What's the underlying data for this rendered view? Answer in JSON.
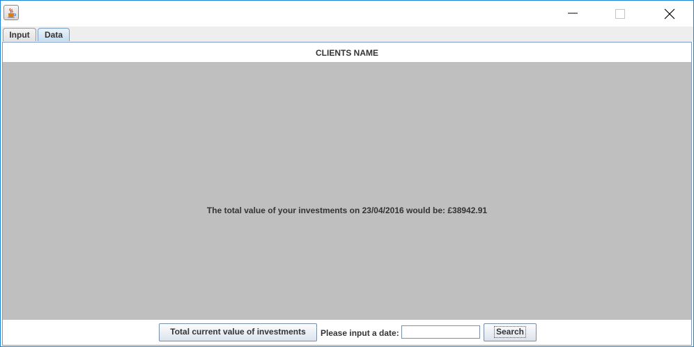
{
  "window": {
    "icon": "java-icon",
    "controls": {
      "minimize": "minimize-icon",
      "maximize": "maximize-icon",
      "close": "close-icon"
    }
  },
  "tabs": [
    {
      "label": "Input",
      "selected": false
    },
    {
      "label": "Data",
      "selected": true
    }
  ],
  "panel": {
    "header": "CLIENTS NAME",
    "result_text": "The total value of your investments on 23/04/2016 would be: £38942.91",
    "background_color": "#bfbfbf"
  },
  "footer": {
    "total_button_label": "Total current value of investments",
    "date_label": "Please input a date:",
    "date_input_value": "",
    "search_button_label": "Search"
  }
}
